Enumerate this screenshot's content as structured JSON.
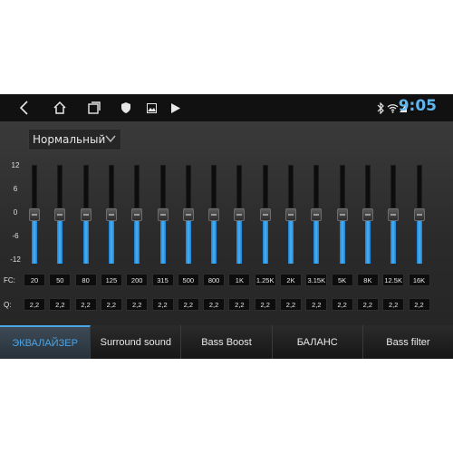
{
  "statusbar": {
    "time": "9:05"
  },
  "preset": {
    "label": "Нормальный"
  },
  "y_axis": [
    "12",
    "6",
    "0",
    "-6",
    "-12"
  ],
  "rows": {
    "fc_label": "FC:",
    "q_label": "Q:"
  },
  "bands": [
    {
      "fc": "20",
      "q": "2,2",
      "gain": 0
    },
    {
      "fc": "50",
      "q": "2,2",
      "gain": 0
    },
    {
      "fc": "80",
      "q": "2,2",
      "gain": 0
    },
    {
      "fc": "125",
      "q": "2,2",
      "gain": 0
    },
    {
      "fc": "200",
      "q": "2,2",
      "gain": 0
    },
    {
      "fc": "315",
      "q": "2,2",
      "gain": 0
    },
    {
      "fc": "500",
      "q": "2,2",
      "gain": 0
    },
    {
      "fc": "800",
      "q": "2,2",
      "gain": 0
    },
    {
      "fc": "1K",
      "q": "2,2",
      "gain": 0
    },
    {
      "fc": "1.25K",
      "q": "2,2",
      "gain": 0
    },
    {
      "fc": "2K",
      "q": "2,2",
      "gain": 0
    },
    {
      "fc": "3.15K",
      "q": "2,2",
      "gain": 0
    },
    {
      "fc": "5K",
      "q": "2,2",
      "gain": 0
    },
    {
      "fc": "8K",
      "q": "2,2",
      "gain": 0
    },
    {
      "fc": "12.5K",
      "q": "2,2",
      "gain": 0
    },
    {
      "fc": "16K",
      "q": "2,2",
      "gain": 0
    }
  ],
  "tabs": [
    {
      "label": "ЭКВАЛАЙЗЕР",
      "active": true
    },
    {
      "label": "Surround sound",
      "active": false
    },
    {
      "label": "Bass Boost",
      "active": false
    },
    {
      "label": "БАЛАНС",
      "active": false
    },
    {
      "label": "Bass filter",
      "active": false
    }
  ],
  "colors": {
    "accent": "#4aa6e8",
    "clock": "#5fb7ef",
    "slider_fill": "#47b2f3"
  }
}
